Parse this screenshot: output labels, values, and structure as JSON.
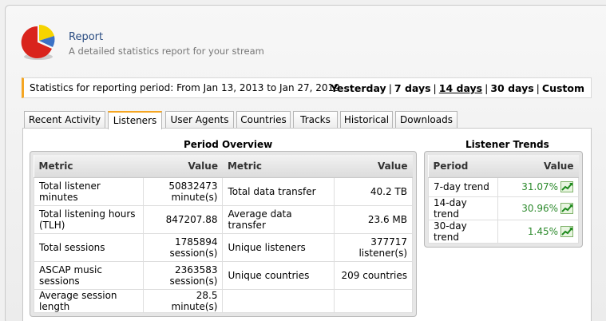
{
  "header": {
    "title": "Report",
    "subtitle": "A detailed statistics report for your stream"
  },
  "period": {
    "text": "Statistics for reporting period: From Jan 13, 2013 to Jan 27, 2019",
    "links": [
      {
        "label": "Yesterday",
        "active": false
      },
      {
        "label": "7 days",
        "active": false
      },
      {
        "label": "14 days",
        "active": true
      },
      {
        "label": "30 days",
        "active": false
      },
      {
        "label": "Custom",
        "active": false
      }
    ]
  },
  "tabs": [
    {
      "label": "Recent Activity",
      "active": false
    },
    {
      "label": "Listeners",
      "active": true
    },
    {
      "label": "User Agents",
      "active": false
    },
    {
      "label": "Countries",
      "active": false
    },
    {
      "label": "Tracks",
      "active": false
    },
    {
      "label": "Historical",
      "active": false
    },
    {
      "label": "Downloads",
      "active": false
    }
  ],
  "overview": {
    "title": "Period Overview",
    "headers": {
      "metric": "Metric",
      "value": "Value"
    },
    "rows": [
      {
        "m1": "Total listener minutes",
        "v1": "50832473 minute(s)",
        "m2": "Total data transfer",
        "v2": "40.2 TB"
      },
      {
        "m1": "Total listening hours (TLH)",
        "v1": "847207.88",
        "m2": "Average data transfer",
        "v2": "23.6 MB"
      },
      {
        "m1": "Total sessions",
        "v1": "1785894 session(s)",
        "m2": "Unique listeners",
        "v2": "377717 listener(s)"
      },
      {
        "m1": "ASCAP music sessions",
        "v1": "2363583 session(s)",
        "m2": "Unique countries",
        "v2": "209 countries"
      },
      {
        "m1": "Average session length",
        "v1": "28.5 minute(s)",
        "m2": "",
        "v2": ""
      }
    ]
  },
  "trends": {
    "title": "Listener Trends",
    "headers": {
      "period": "Period",
      "value": "Value"
    },
    "rows": [
      {
        "period": "7-day trend",
        "value": "31.07%",
        "icon": "trend-up-icon"
      },
      {
        "period": "14-day trend",
        "value": "30.96%",
        "icon": "trend-up-icon"
      },
      {
        "period": "30-day trend",
        "value": "1.45%",
        "icon": "trend-up-icon"
      }
    ]
  },
  "colors": {
    "accent": "#f5a623",
    "title": "#2a4c82",
    "positive": "#2e8b2e"
  }
}
